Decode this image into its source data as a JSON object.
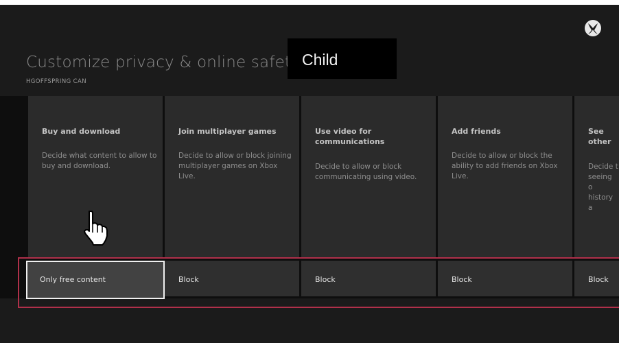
{
  "page": {
    "title": "Customize privacy & online safety for",
    "account_name": "Child",
    "subtitle": "HGOFFSPRING CAN"
  },
  "icons": {
    "brand": "xbox-logo-icon",
    "pointer": "hand-pointer-icon"
  },
  "colors": {
    "background": "#1b1b1b",
    "card": "#2b2b2b",
    "selection_outline": "#b0304a"
  },
  "settings": [
    {
      "title": "Buy and download",
      "description": "Decide what content to allow to buy and download.",
      "value": "Only free content",
      "selected": true
    },
    {
      "title": "Join multiplayer games",
      "description": "Decide to allow or block joining multiplayer games on Xbox Live.",
      "value": "Block",
      "selected": false
    },
    {
      "title": "Use video for communications",
      "description": "Decide to allow or block communicating using video.",
      "value": "Block",
      "selected": false
    },
    {
      "title": "Add friends",
      "description": "Decide to allow or block the ability to add friends on Xbox Live.",
      "value": "Block",
      "selected": false
    },
    {
      "title": "See other Live pro",
      "description": "Decide t seeing o history a",
      "value": "Block",
      "selected": false
    }
  ]
}
